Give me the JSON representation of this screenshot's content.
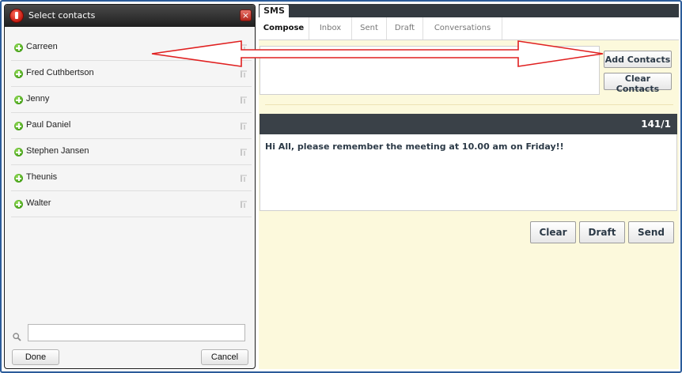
{
  "dialog": {
    "title": "Select contacts",
    "close_label": "×",
    "contacts": [
      {
        "name": "Carreen"
      },
      {
        "name": "Fred Cuthbertson"
      },
      {
        "name": "Jenny"
      },
      {
        "name": "Paul Daniel"
      },
      {
        "name": "Stephen Jansen"
      },
      {
        "name": "Theunis"
      },
      {
        "name": "Walter"
      }
    ],
    "search_value": "",
    "done_label": "Done",
    "cancel_label": "Cancel"
  },
  "app": {
    "title": "SMS",
    "tabs": [
      {
        "label": "Compose",
        "active": true
      },
      {
        "label": "Inbox"
      },
      {
        "label": "Sent"
      },
      {
        "label": "Draft"
      },
      {
        "label": "Conversations"
      }
    ],
    "add_contacts_label": "Add Contacts",
    "clear_contacts_label": "Clear Contacts",
    "message_counter": "141/1",
    "message_text": "Hi All, please remember the meeting at 10.00 am on Friday!!",
    "clear_label": "Clear",
    "draft_label": "Draft",
    "send_label": "Send"
  },
  "annotation": {
    "arrow_color": "#e02020"
  }
}
